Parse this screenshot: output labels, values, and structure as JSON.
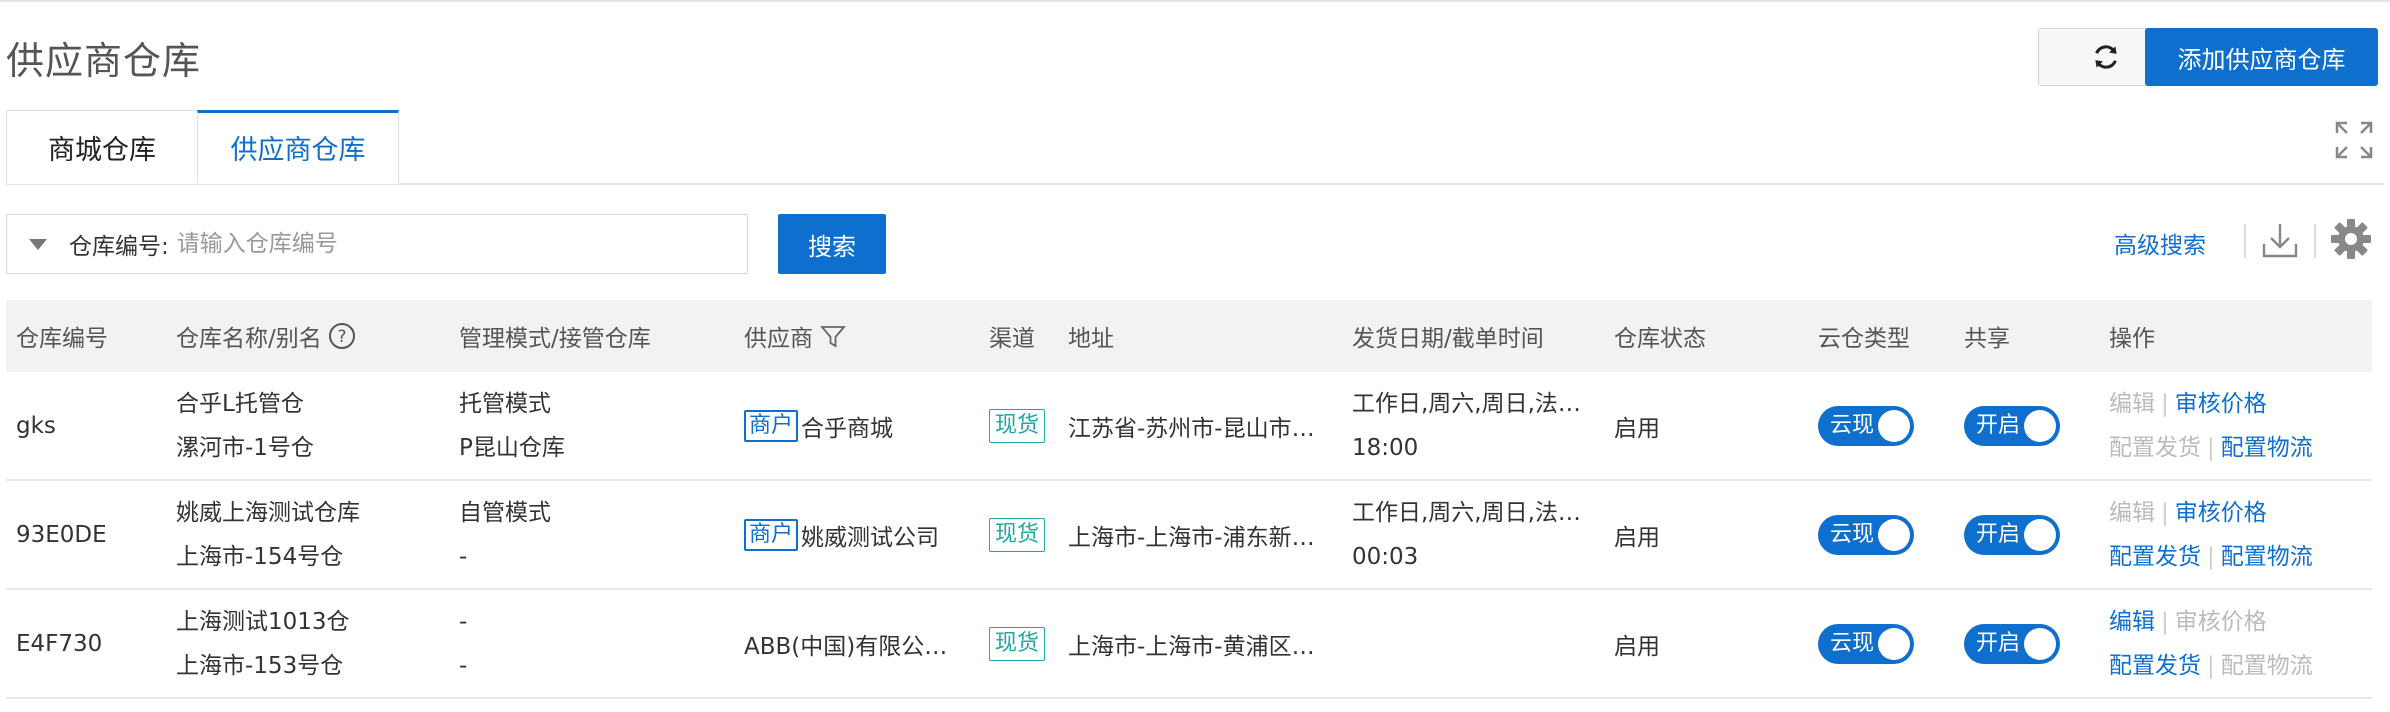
{
  "page": {
    "title": "供应商仓库"
  },
  "header": {
    "add_button_label": "添加供应商仓库"
  },
  "tabs": [
    {
      "label": "商城仓库",
      "active": false
    },
    {
      "label": "供应商仓库",
      "active": true
    }
  ],
  "search": {
    "label": "仓库编号:",
    "placeholder": "请输入仓库编号",
    "value": "",
    "button_label": "搜索"
  },
  "toolbar": {
    "advanced_search_label": "高级搜索"
  },
  "colors": {
    "primary": "#0f6fcf",
    "stock_tag": "#23a6a6",
    "disabled": "#bbbbbb"
  },
  "table": {
    "columns": [
      "仓库编号",
      "仓库名称/别名",
      "管理模式/接管仓库",
      "供应商",
      "渠道",
      "地址",
      "发货日期/截单时间",
      "仓库状态",
      "云仓类型",
      "共享",
      "操作"
    ],
    "rows": [
      {
        "code": "gks",
        "name": "合乎L托管仓",
        "alias": "漯河市-1号仓",
        "mode": "托管模式",
        "takeover": "P昆山仓库",
        "supplier_tag": "商户",
        "supplier": "合乎商城",
        "channel": "现货",
        "address": "江苏省-苏州市-昆山市…",
        "ship_days": "工作日,周六,周日,法…",
        "cutoff": "18:00",
        "status": "启用",
        "cloud_type": "云现",
        "share": "开启",
        "ops": [
          {
            "label": "编辑",
            "enabled": false
          },
          {
            "label": "审核价格",
            "enabled": true
          },
          {
            "label": "配置发货",
            "enabled": false
          },
          {
            "label": "配置物流",
            "enabled": true
          }
        ]
      },
      {
        "code": "93E0DE",
        "name": "姚威上海测试仓库",
        "alias": "上海市-154号仓",
        "mode": "自管模式",
        "takeover": "-",
        "supplier_tag": "商户",
        "supplier": "姚威测试公司",
        "channel": "现货",
        "address": "上海市-上海市-浦东新…",
        "ship_days": "工作日,周六,周日,法…",
        "cutoff": "00:03",
        "status": "启用",
        "cloud_type": "云现",
        "share": "开启",
        "ops": [
          {
            "label": "编辑",
            "enabled": false
          },
          {
            "label": "审核价格",
            "enabled": true
          },
          {
            "label": "配置发货",
            "enabled": true
          },
          {
            "label": "配置物流",
            "enabled": true
          }
        ]
      },
      {
        "code": "E4F730",
        "name": "上海测试1013仓",
        "alias": "上海市-153号仓",
        "mode": "-",
        "takeover": "-",
        "supplier_tag": "",
        "supplier": "ABB(中国)有限公…",
        "channel": "现货",
        "address": "上海市-上海市-黄浦区…",
        "ship_days": "",
        "cutoff": "",
        "status": "启用",
        "cloud_type": "云现",
        "share": "开启",
        "ops": [
          {
            "label": "编辑",
            "enabled": true
          },
          {
            "label": "审核价格",
            "enabled": false
          },
          {
            "label": "配置发货",
            "enabled": true
          },
          {
            "label": "配置物流",
            "enabled": false
          }
        ]
      }
    ]
  }
}
